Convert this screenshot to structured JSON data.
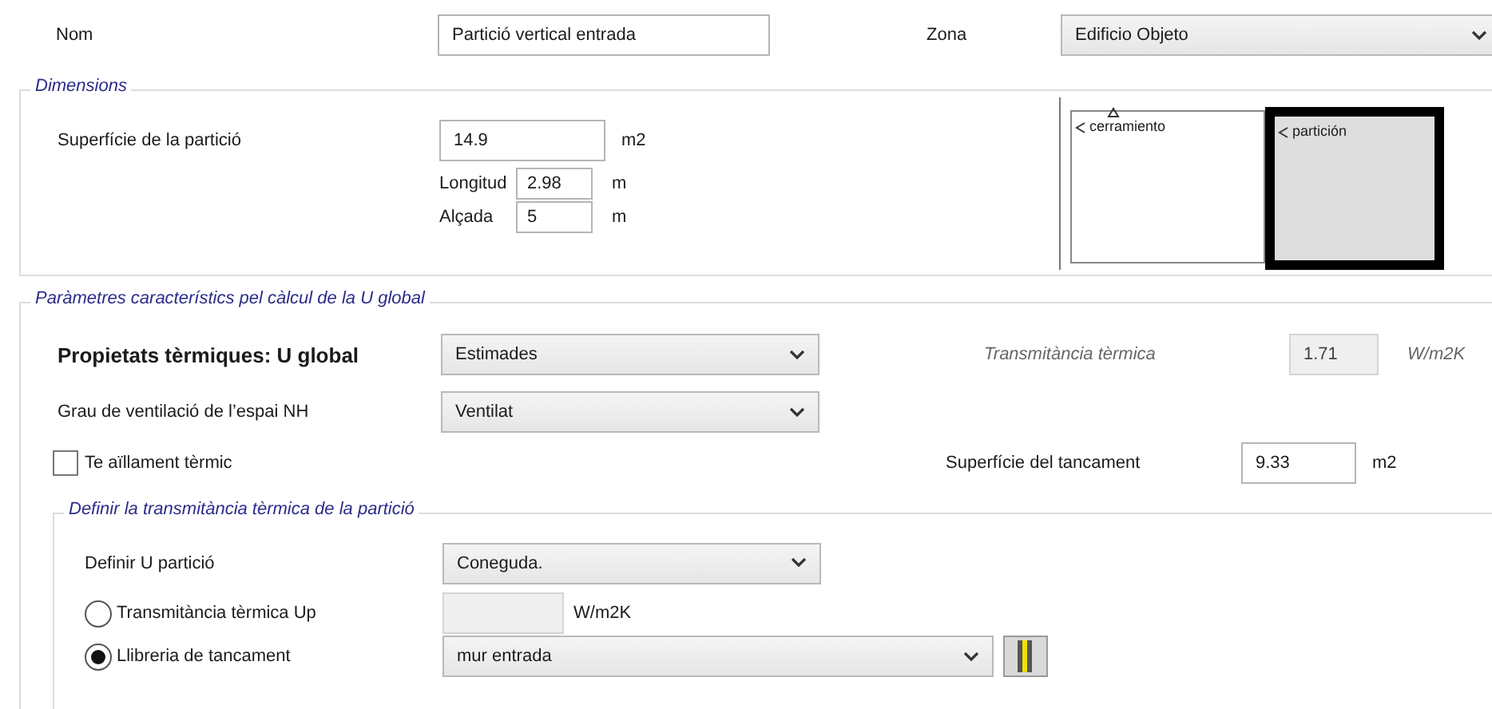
{
  "name": {
    "label": "Nom",
    "value": "Partició vertical entrada"
  },
  "zone": {
    "label": "Zona",
    "value": "Edificio Objeto"
  },
  "dimensions": {
    "title": "Dimensions",
    "surface": {
      "label": "Superfície de la partició",
      "value": "14.9",
      "unit": "m2"
    },
    "length": {
      "label": "Longitud",
      "value": "2.98",
      "unit": "m"
    },
    "height": {
      "label": "Alçada",
      "value": "5",
      "unit": "m"
    },
    "diagram": {
      "left_label": "cerramiento",
      "right_label": "partición"
    }
  },
  "parameters": {
    "title": "Paràmetres característics pel càlcul de la U global",
    "thermal_properties": {
      "label": "Propietats tèrmiques: U global",
      "value": "Estimades"
    },
    "transmittance": {
      "label": "Transmitància tèrmica",
      "value": "1.71",
      "unit": "W/m2K",
      "disabled": true
    },
    "ventilation": {
      "label": "Grau de ventilació de l’espai NH",
      "value": "Ventilat"
    },
    "insulation": {
      "label": "Te aïllament tèrmic",
      "checked": false
    },
    "closure_surface": {
      "label": "Superfície del tancament",
      "value": "9.33",
      "unit": "m2"
    },
    "partition": {
      "title": "Definir la transmitància tèrmica de la partició",
      "define_u": {
        "label": "Definir U partició",
        "value": "Coneguda."
      },
      "options": [
        {
          "kind": "input",
          "label": "Transmitància tèrmica Up",
          "selected": false,
          "unit": "W/m2K"
        },
        {
          "kind": "select",
          "label": "Llibreria de tancament",
          "selected": true,
          "value": "mur entrada"
        }
      ]
    }
  }
}
